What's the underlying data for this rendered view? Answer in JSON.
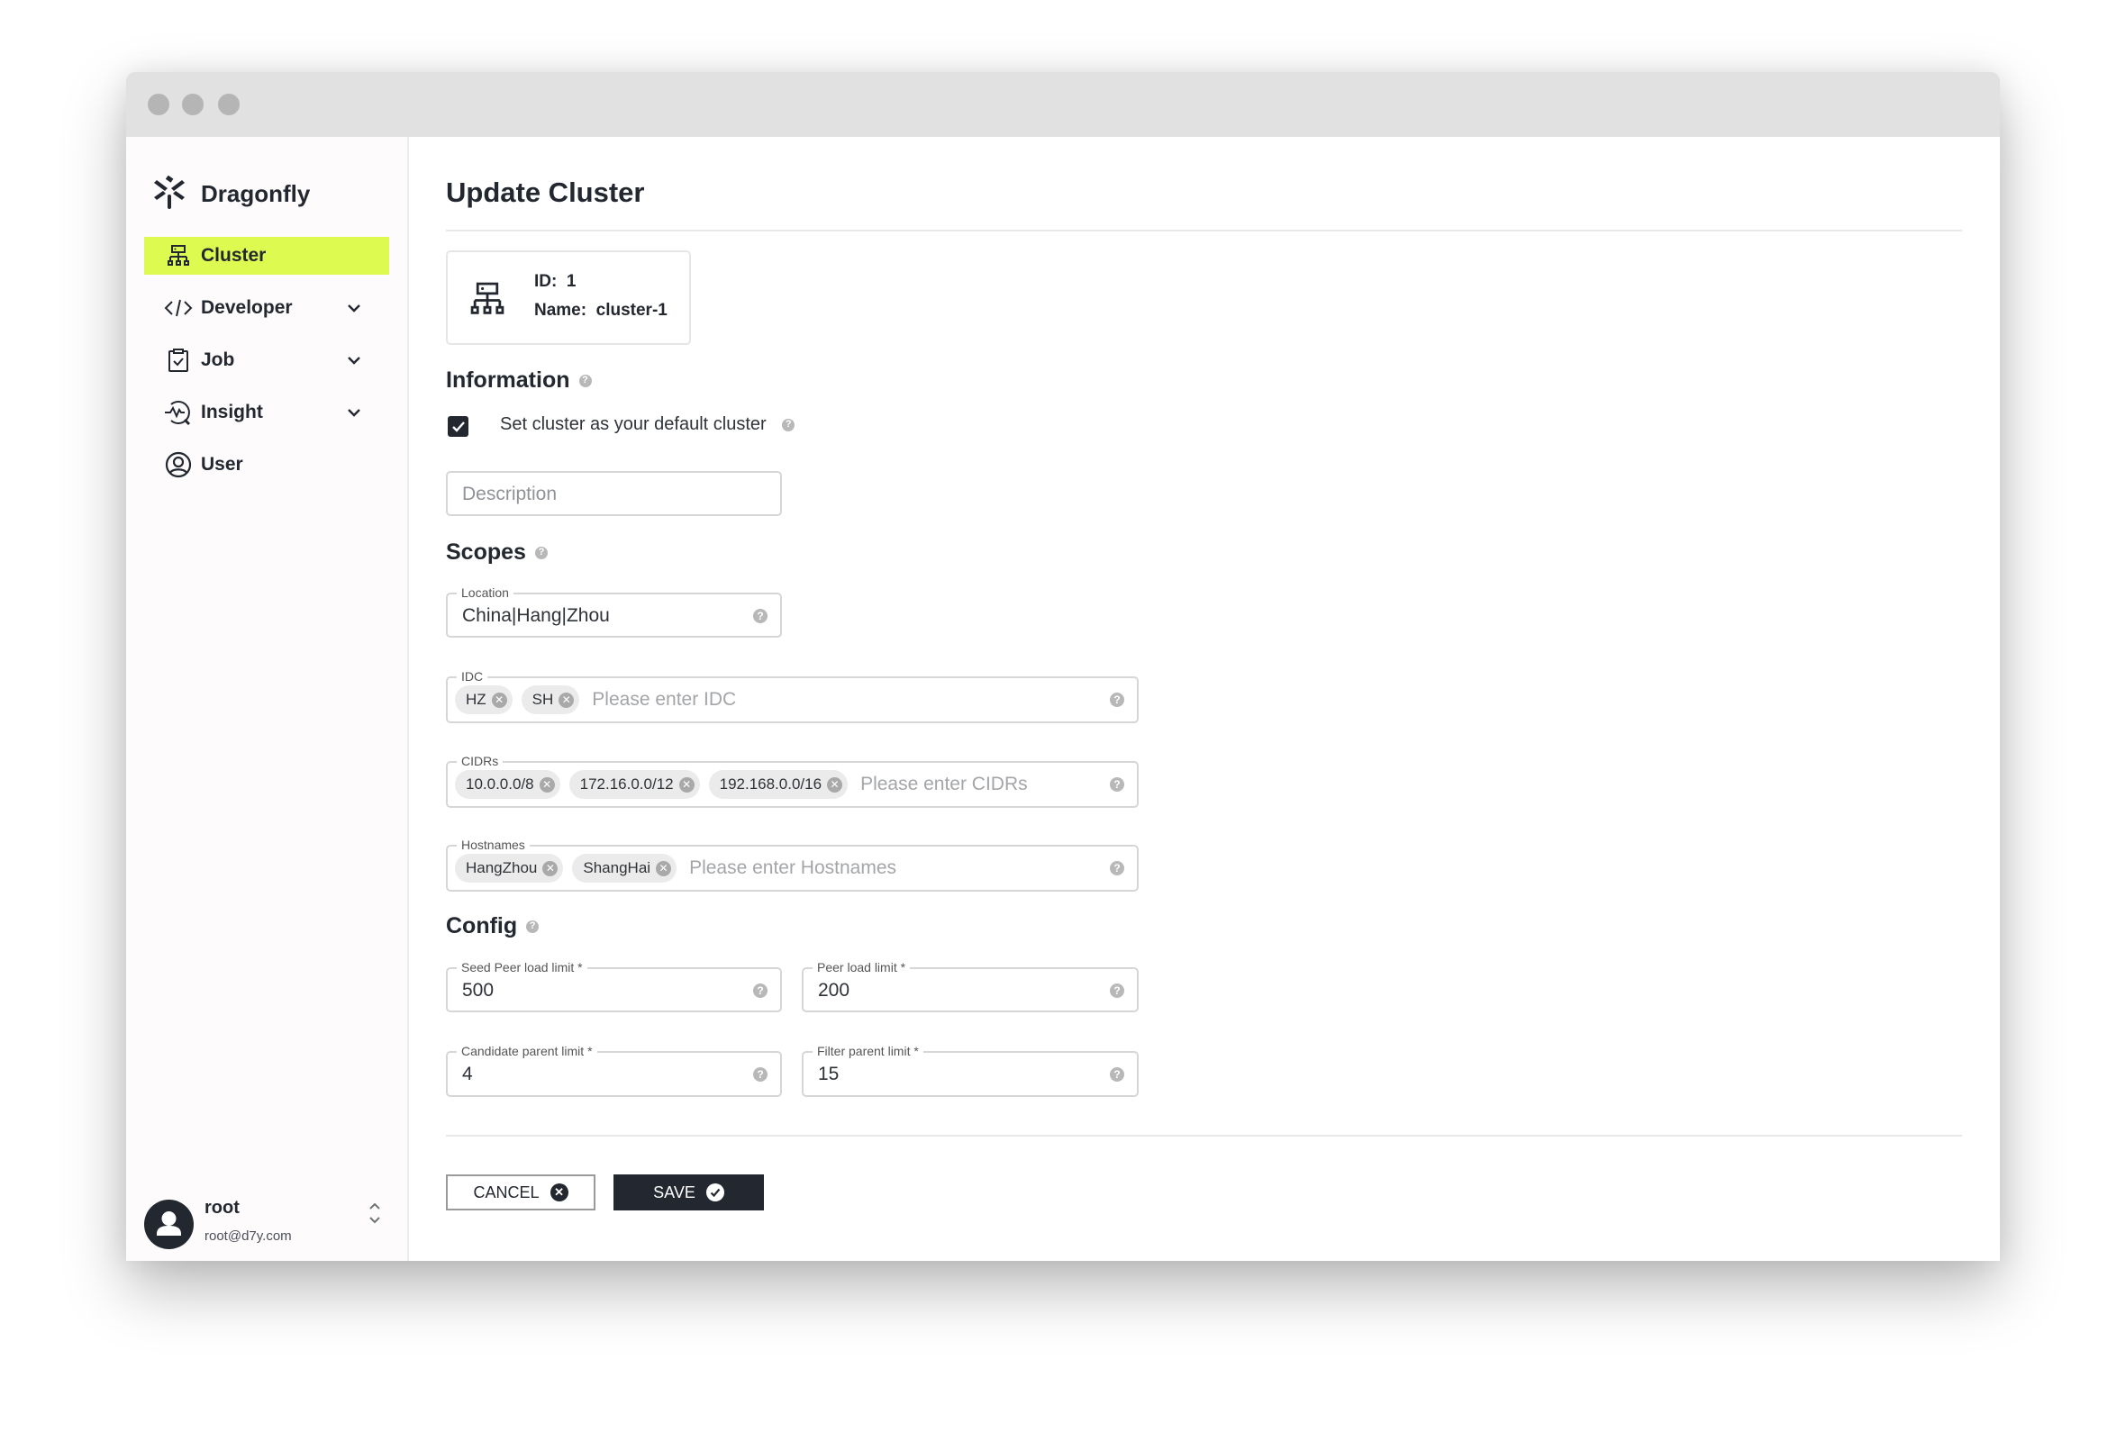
{
  "window": {
    "controls": [
      "close",
      "minimize",
      "maximize"
    ]
  },
  "sidebar": {
    "brand": "Dragonfly",
    "brand_icon": "dragonfly-logo-icon",
    "items": [
      {
        "label": "Cluster",
        "icon": "cluster-icon",
        "active": true,
        "expandable": false
      },
      {
        "label": "Developer",
        "icon": "code-icon",
        "active": false,
        "expandable": true
      },
      {
        "label": "Job",
        "icon": "clipboard-check-icon",
        "active": false,
        "expandable": true
      },
      {
        "label": "Insight",
        "icon": "insight-icon",
        "active": false,
        "expandable": true
      },
      {
        "label": "User",
        "icon": "user-circle-icon",
        "active": false,
        "expandable": false
      }
    ],
    "user": {
      "name": "root",
      "email": "root@d7y.com"
    },
    "accent": "#dcfa50"
  },
  "main": {
    "title": "Update Cluster",
    "card": {
      "id_label": "ID:",
      "id_value": "1",
      "name_label": "Name:",
      "name_value": "cluster-1"
    },
    "information": {
      "heading": "Information",
      "default_checkbox": {
        "label": "Set cluster as your default cluster",
        "checked": true
      },
      "description": {
        "placeholder": "Description",
        "value": ""
      }
    },
    "scopes": {
      "heading": "Scopes",
      "location": {
        "label": "Location",
        "value": "China|Hang|Zhou"
      },
      "idc": {
        "label": "IDC",
        "chips": [
          "HZ",
          "SH"
        ],
        "placeholder": "Please enter IDC"
      },
      "cidrs": {
        "label": "CIDRs",
        "chips": [
          "10.0.0.0/8",
          "172.16.0.0/12",
          "192.168.0.0/16"
        ],
        "placeholder": "Please enter CIDRs"
      },
      "hostnames": {
        "label": "Hostnames",
        "chips": [
          "HangZhou",
          "ShangHai"
        ],
        "placeholder": "Please enter Hostnames"
      }
    },
    "config": {
      "heading": "Config",
      "seed_peer_load_limit": {
        "label": "Seed Peer load limit *",
        "value": "500"
      },
      "peer_load_limit": {
        "label": "Peer load limit *",
        "value": "200"
      },
      "candidate_parent_limit": {
        "label": "Candidate parent limit *",
        "value": "4"
      },
      "filter_parent_limit": {
        "label": "Filter parent limit *",
        "value": "15"
      }
    },
    "actions": {
      "cancel_label": "CANCEL",
      "save_label": "SAVE"
    }
  }
}
